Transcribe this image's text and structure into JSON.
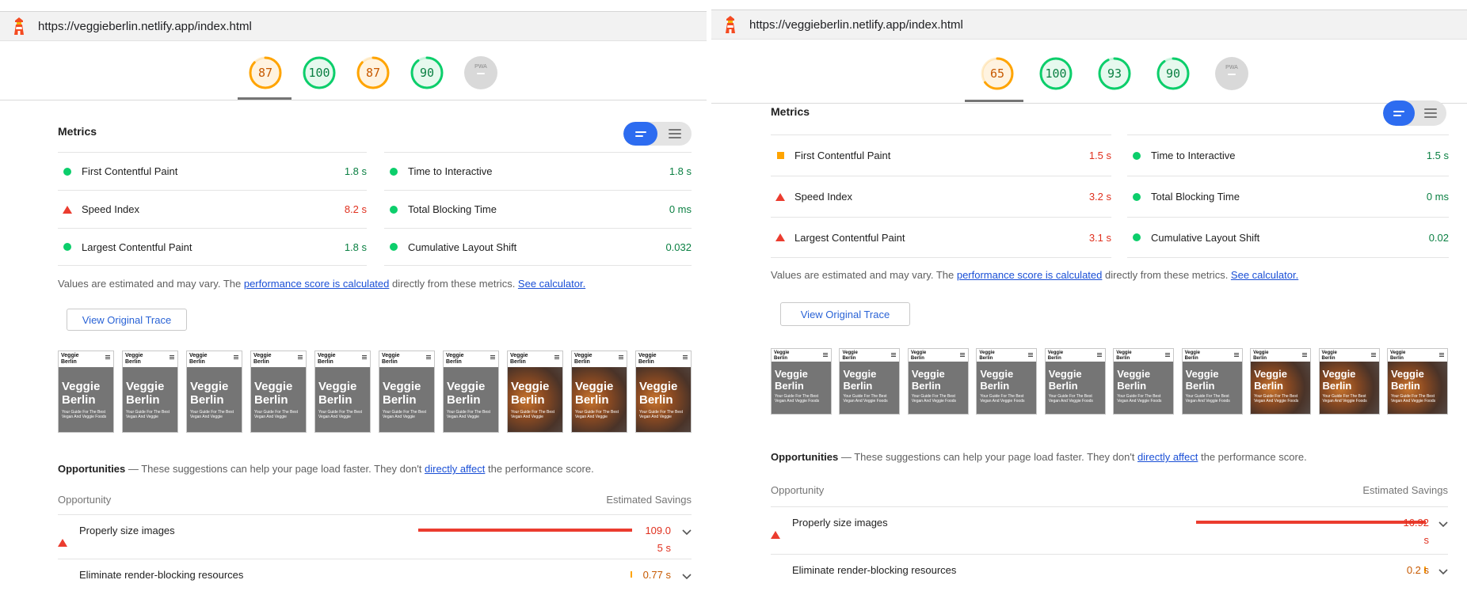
{
  "colors": {
    "pass": "#0cce6b",
    "average": "#ffa400",
    "fail": "#eb3c2f",
    "na": "#d9d9d9",
    "link": "#1a4fd6",
    "toggle_active": "#2d6cf0"
  },
  "left": {
    "url": "https://veggieberlin.netlify.app/index.html",
    "scores": [
      {
        "value": "87",
        "level": "average"
      },
      {
        "value": "100",
        "level": "pass"
      },
      {
        "value": "87",
        "level": "average"
      },
      {
        "value": "90",
        "level": "pass"
      }
    ],
    "pwa_label": "PWA",
    "metrics_title": "Metrics",
    "metrics_left": [
      {
        "name": "First Contentful Paint",
        "value": "1.8 s",
        "status": "pass"
      },
      {
        "name": "Speed Index",
        "value": "8.2 s",
        "status": "fail"
      },
      {
        "name": "Largest Contentful Paint",
        "value": "1.8 s",
        "status": "pass"
      }
    ],
    "metrics_right": [
      {
        "name": "Time to Interactive",
        "value": "1.8 s",
        "status": "pass"
      },
      {
        "name": "Total Blocking Time",
        "value": "0 ms",
        "status": "pass"
      },
      {
        "name": "Cumulative Layout Shift",
        "value": "0.032",
        "status": "pass"
      }
    ],
    "note_prefix": "Values are estimated and may vary. The ",
    "note_link1": "performance score is calculated",
    "note_mid": " directly from these metrics. ",
    "note_link2": "See calculator.",
    "trace_button": "View Original Trace",
    "frames": [
      {
        "logo": "Veggie Berlin",
        "title": "Veggie Berlin",
        "subtitle": "Your Guide For The Best Vegan And Veggie Foods",
        "image": false
      },
      {
        "logo": "Veggie Berlin",
        "title": "Veggie Berlin",
        "subtitle": "Your Guide For The Best Vegan And Veggie",
        "image": false
      },
      {
        "logo": "Veggie Berlin",
        "title": "Veggie Berlin",
        "subtitle": "Your Guide For The Best Vegan And Veggie",
        "image": false
      },
      {
        "logo": "Veggie Berlin",
        "title": "Veggie Berlin",
        "subtitle": "Your Guide For The Best Vegan And Veggie",
        "image": false
      },
      {
        "logo": "Veggie Berlin",
        "title": "Veggie Berlin",
        "subtitle": "Your Guide For The Best Vegan And Veggie",
        "image": false
      },
      {
        "logo": "Veggie Berlin",
        "title": "Veggie Berlin",
        "subtitle": "Your Guide For The Best Vegan And Veggie",
        "image": false
      },
      {
        "logo": "Veggie Berlin",
        "title": "Veggie Berlin",
        "subtitle": "Your Guide For The Best Vegan And Veggie",
        "image": false
      },
      {
        "logo": "Veggie Berlin",
        "title": "Veggie Berlin",
        "subtitle": "Your Guide For The Best Vegan And Veggie",
        "image": true
      },
      {
        "logo": "Veggie Berlin",
        "title": "Veggie Berlin",
        "subtitle": "Your Guide For The Best Vegan And Veggie",
        "image": true
      },
      {
        "logo": "Veggie Berlin",
        "title": "Veggie Berlin",
        "subtitle": "Your Guide For The Best Vegan And Veggie",
        "image": true
      }
    ],
    "opp_title": "Opportunities",
    "opp_dash": " — ",
    "opp_desc_prefix": "These suggestions can help your page load faster. They don't ",
    "opp_desc_link": "directly affect",
    "opp_desc_suffix": " the performance score.",
    "col_opportunity": "Opportunity",
    "col_savings": "Estimated Savings",
    "opportunities": [
      {
        "name": "Properly size images",
        "savings_line1": "109.0",
        "savings_line2": "5 s",
        "status": "fail",
        "bar_fraction": 1.0
      },
      {
        "name": "Eliminate render-blocking resources",
        "savings_line1": "0.77 s",
        "savings_line2": "",
        "status": "average",
        "bar_fraction": 0.01
      }
    ]
  },
  "right": {
    "url": "https://veggieberlin.netlify.app/index.html",
    "scores": [
      {
        "value": "65",
        "level": "average"
      },
      {
        "value": "100",
        "level": "pass"
      },
      {
        "value": "93",
        "level": "pass"
      },
      {
        "value": "90",
        "level": "pass"
      }
    ],
    "pwa_label": "PWA",
    "metrics_title": "Metrics",
    "metrics_left": [
      {
        "name": "First Contentful Paint",
        "value": "1.5 s",
        "status": "average"
      },
      {
        "name": "Speed Index",
        "value": "3.2 s",
        "status": "fail"
      },
      {
        "name": "Largest Contentful Paint",
        "value": "3.1 s",
        "status": "fail"
      }
    ],
    "metrics_right": [
      {
        "name": "Time to Interactive",
        "value": "1.5 s",
        "status": "pass"
      },
      {
        "name": "Total Blocking Time",
        "value": "0 ms",
        "status": "pass"
      },
      {
        "name": "Cumulative Layout Shift",
        "value": "0.02",
        "status": "pass"
      }
    ],
    "note_prefix": "Values are estimated and may vary. The ",
    "note_link1": "performance score is calculated",
    "note_mid": " directly from these metrics. ",
    "note_link2": "See calculator.",
    "trace_button": "View Original Trace",
    "frames": [
      {
        "logo": "Veggie Berlin",
        "title": "Veggie Berlin",
        "subtitle": "Your Guide For The Best Vegan And Veggie Foods",
        "image": false
      },
      {
        "logo": "Veggie Berlin",
        "title": "Veggie Berlin",
        "subtitle": "Your Guide For The Best Vegan And Veggie Foods",
        "image": false
      },
      {
        "logo": "Veggie Berlin",
        "title": "Veggie Berlin",
        "subtitle": "Your Guide For The Best Vegan And Veggie Foods",
        "image": false
      },
      {
        "logo": "Veggie Berlin",
        "title": "Veggie Berlin",
        "subtitle": "Your Guide For The Best Vegan And Veggie Foods",
        "image": false
      },
      {
        "logo": "Veggie Berlin",
        "title": "Veggie Berlin",
        "subtitle": "Your Guide For The Best Vegan And Veggie Foods",
        "image": false
      },
      {
        "logo": "Veggie Berlin",
        "title": "Veggie Berlin",
        "subtitle": "Your Guide For The Best Vegan And Veggie Foods",
        "image": false
      },
      {
        "logo": "Veggie Berlin",
        "title": "Veggie Berlin",
        "subtitle": "Your Guide For The Best Vegan And Veggie Foods",
        "image": false
      },
      {
        "logo": "Veggie Berlin",
        "title": "Veggie Berlin",
        "subtitle": "Your Guide For The Best Vegan And Veggie Foods",
        "image": true
      },
      {
        "logo": "Veggie Berlin",
        "title": "Veggie Berlin",
        "subtitle": "Your Guide For The Best Vegan And Veggie Foods",
        "image": true
      },
      {
        "logo": "Veggie Berlin",
        "title": "Veggie Berlin",
        "subtitle": "Your Guide For The Best Vegan And Veggie Foods",
        "image": true
      }
    ],
    "opp_title": "Opportunities",
    "opp_dash": " — ",
    "opp_desc_prefix": "These suggestions can help your page load faster. They don't ",
    "opp_desc_link": "directly affect",
    "opp_desc_suffix": " the performance score.",
    "col_opportunity": "Opportunity",
    "col_savings": "Estimated Savings",
    "opportunities": [
      {
        "name": "Properly size images",
        "savings_line1": "16.92",
        "savings_line2": "s",
        "status": "fail",
        "bar_fraction": 1.0
      },
      {
        "name": "Eliminate render-blocking resources",
        "savings_line1": "0.2 s",
        "savings_line2": "",
        "status": "average",
        "bar_fraction": 0.01
      }
    ]
  }
}
